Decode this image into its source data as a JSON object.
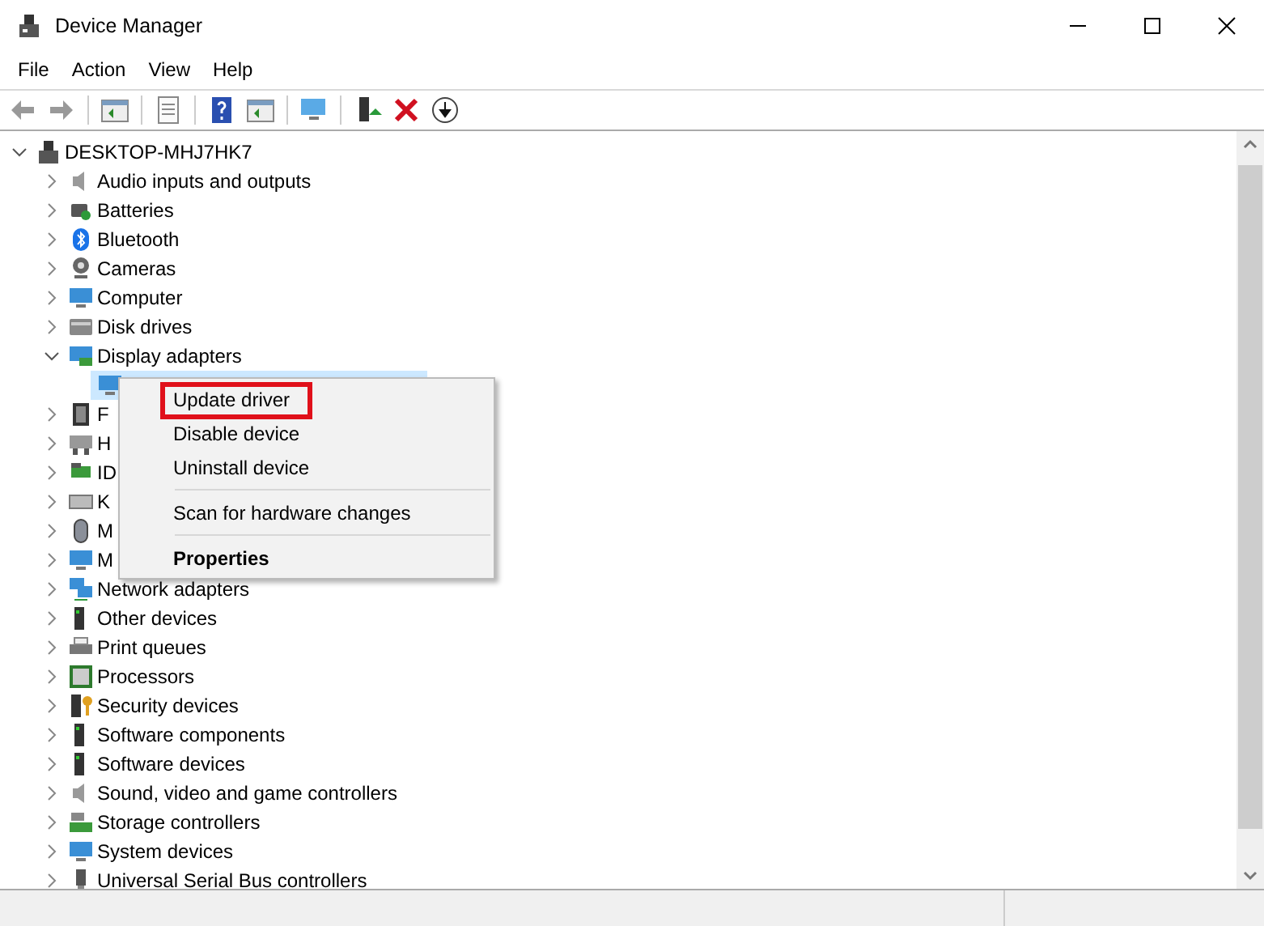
{
  "window": {
    "title": "Device Manager"
  },
  "menu_bar": [
    "File",
    "Action",
    "View",
    "Help"
  ],
  "tree": {
    "label": "DESKTOP-MHJ7HK7",
    "expanded": true,
    "children": [
      {
        "label": "Audio inputs and outputs",
        "expanded": false
      },
      {
        "label": "Batteries",
        "expanded": false
      },
      {
        "label": "Bluetooth",
        "expanded": false
      },
      {
        "label": "Cameras",
        "expanded": false
      },
      {
        "label": "Computer",
        "expanded": false
      },
      {
        "label": "Disk drives",
        "expanded": false
      },
      {
        "label": "Display adapters",
        "expanded": true,
        "children": [
          {
            "selected": true
          }
        ]
      },
      {
        "label": "F",
        "expanded": false
      },
      {
        "label": "H",
        "expanded": false
      },
      {
        "label": "ID",
        "expanded": false
      },
      {
        "label": "K",
        "expanded": false
      },
      {
        "label": "M",
        "expanded": false
      },
      {
        "label": "M",
        "expanded": false
      },
      {
        "label": "Network adapters",
        "expanded": false
      },
      {
        "label": "Other devices",
        "expanded": false
      },
      {
        "label": "Print queues",
        "expanded": false
      },
      {
        "label": "Processors",
        "expanded": false
      },
      {
        "label": "Security devices",
        "expanded": false
      },
      {
        "label": "Software components",
        "expanded": false
      },
      {
        "label": "Software devices",
        "expanded": false
      },
      {
        "label": "Sound, video and game controllers",
        "expanded": false
      },
      {
        "label": "Storage controllers",
        "expanded": false
      },
      {
        "label": "System devices",
        "expanded": false
      },
      {
        "label": "Universal Serial Bus controllers",
        "expanded": false
      }
    ]
  },
  "context_menu": {
    "items": [
      {
        "kind": "item",
        "label": "Update driver",
        "default": false,
        "highlighted": true
      },
      {
        "kind": "item",
        "label": "Disable device",
        "default": false,
        "highlighted": false
      },
      {
        "kind": "item",
        "label": "Uninstall device",
        "default": false,
        "highlighted": false
      },
      {
        "kind": "separator"
      },
      {
        "kind": "item",
        "label": "Scan for hardware changes",
        "default": false,
        "highlighted": false
      },
      {
        "kind": "separator"
      },
      {
        "kind": "item",
        "label": "Properties",
        "default": true,
        "highlighted": false
      }
    ]
  }
}
